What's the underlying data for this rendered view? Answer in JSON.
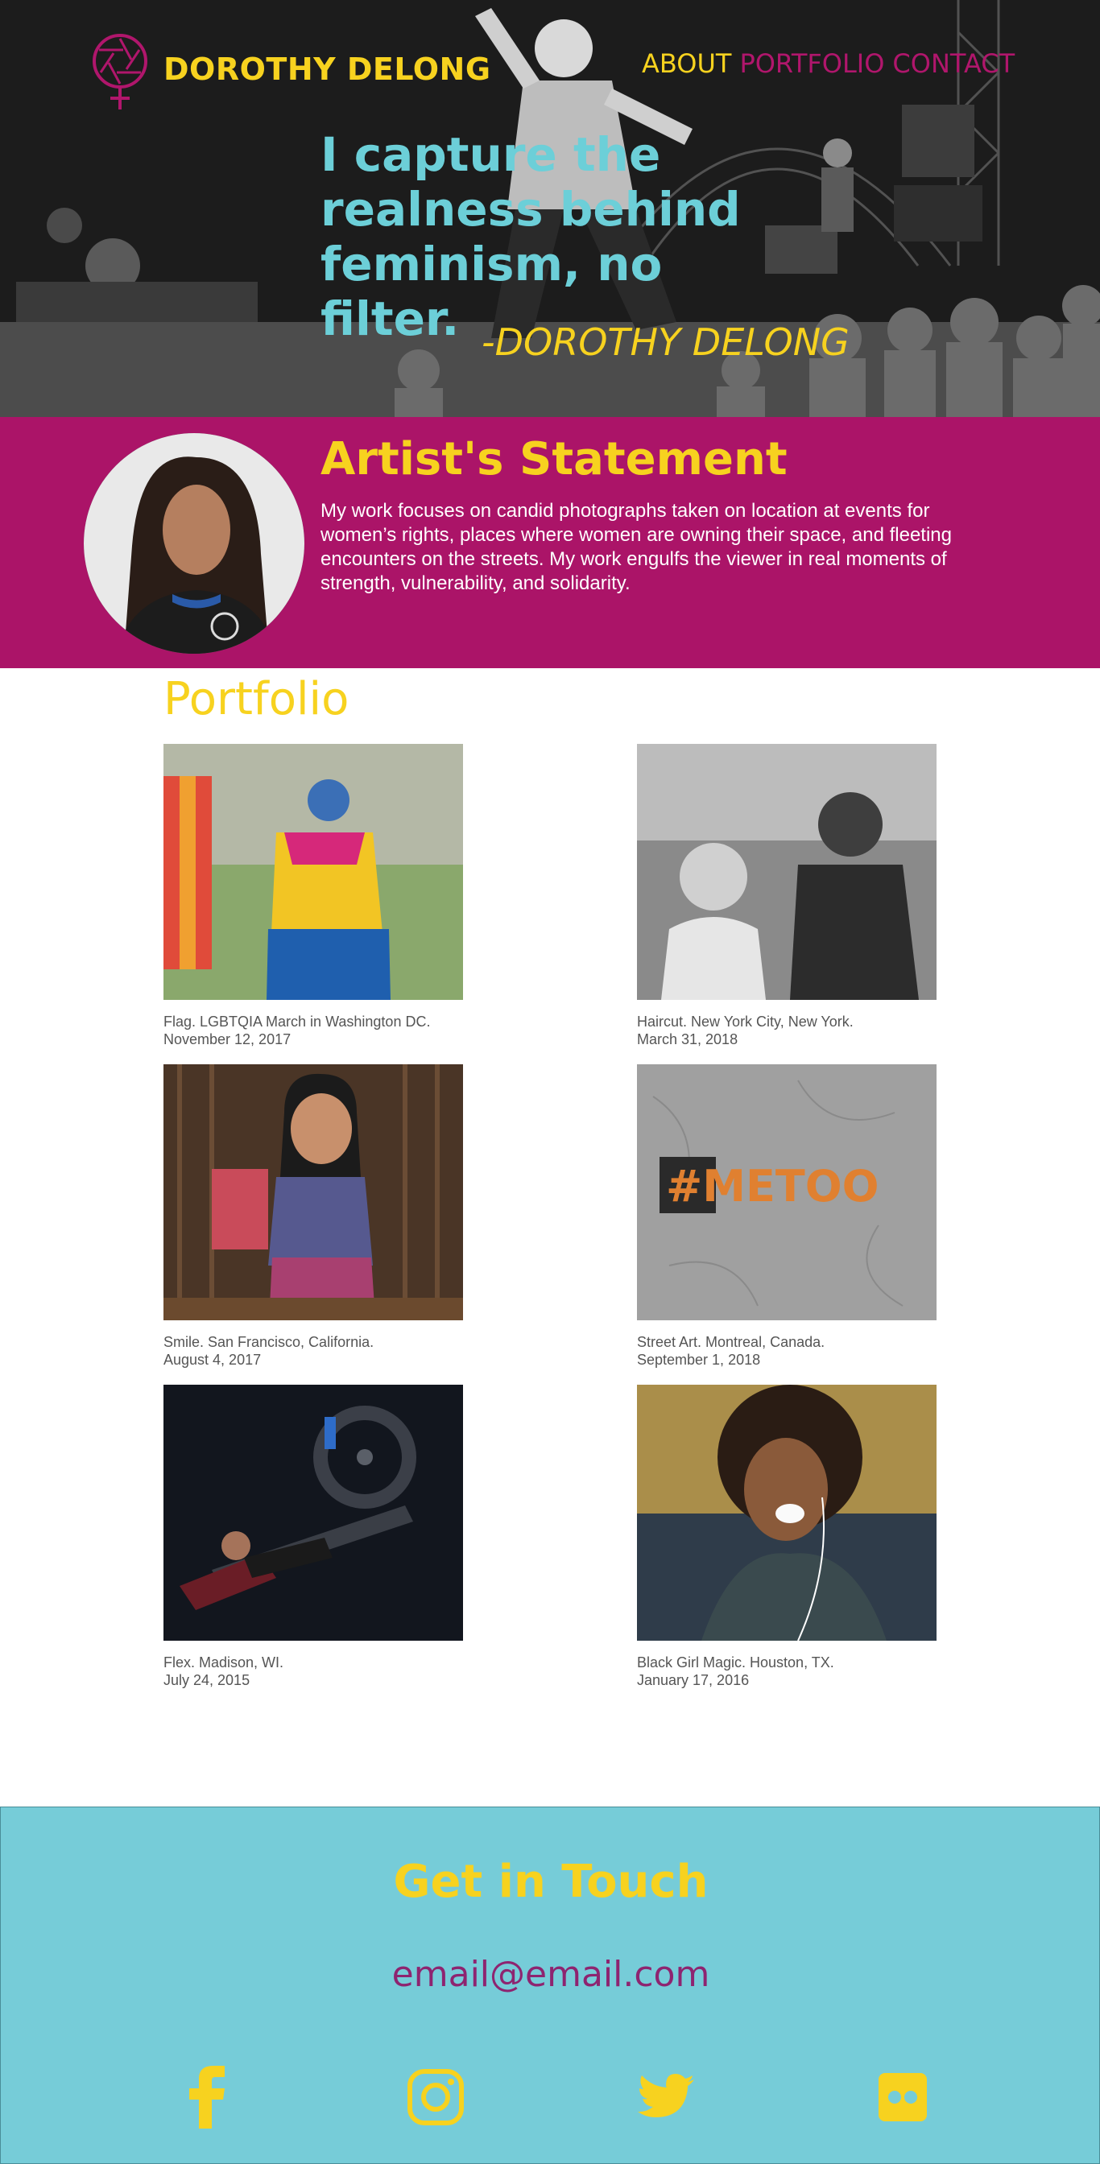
{
  "brand": {
    "name": "DOROTHY DELONG",
    "logo_icon": "venus-aperture-icon"
  },
  "nav": {
    "about": "ABOUT",
    "portfolio": "PORTFOLIO",
    "contact": "CONTACT"
  },
  "hero": {
    "quote": "I capture the realness behind feminism, no filter.",
    "author": "-DOROTHY DELONG"
  },
  "statement": {
    "title": "Artist's Statement",
    "body": "My work focuses on candid photographs taken on location at events for women’s rights, places where women are owning their space, and fleeting encounters on the streets. My work engulfs the viewer in real moments of strength, vulnerability, and solidarity."
  },
  "portfolio": {
    "title": "Portfolio",
    "items": [
      {
        "caption": "Flag. LGBTQIA March in Washington DC.",
        "date": "November 12, 2017"
      },
      {
        "caption": "Haircut. New York City, New York.",
        "date": "March 31, 2018"
      },
      {
        "caption": "Smile. San Francisco, California.",
        "date": "August 4, 2017"
      },
      {
        "caption": "Street Art. Montreal, Canada.",
        "date": "September 1, 2018"
      },
      {
        "caption": "Flex. Madison, WI.",
        "date": "July 24, 2015"
      },
      {
        "caption": "Black Girl Magic. Houston, TX.",
        "date": "January 17, 2016"
      }
    ]
  },
  "street_art_text": "#METOO",
  "footer": {
    "title": "Get in Touch",
    "email": "email@email.com",
    "social": [
      "facebook-icon",
      "instagram-icon",
      "twitter-icon",
      "flickr-icon"
    ]
  },
  "colors": {
    "yellow": "#f7d21f",
    "magenta": "#ab1468",
    "teal": "#6ccfd8",
    "footer_bg": "#76ccd8",
    "email": "#8e2470"
  }
}
